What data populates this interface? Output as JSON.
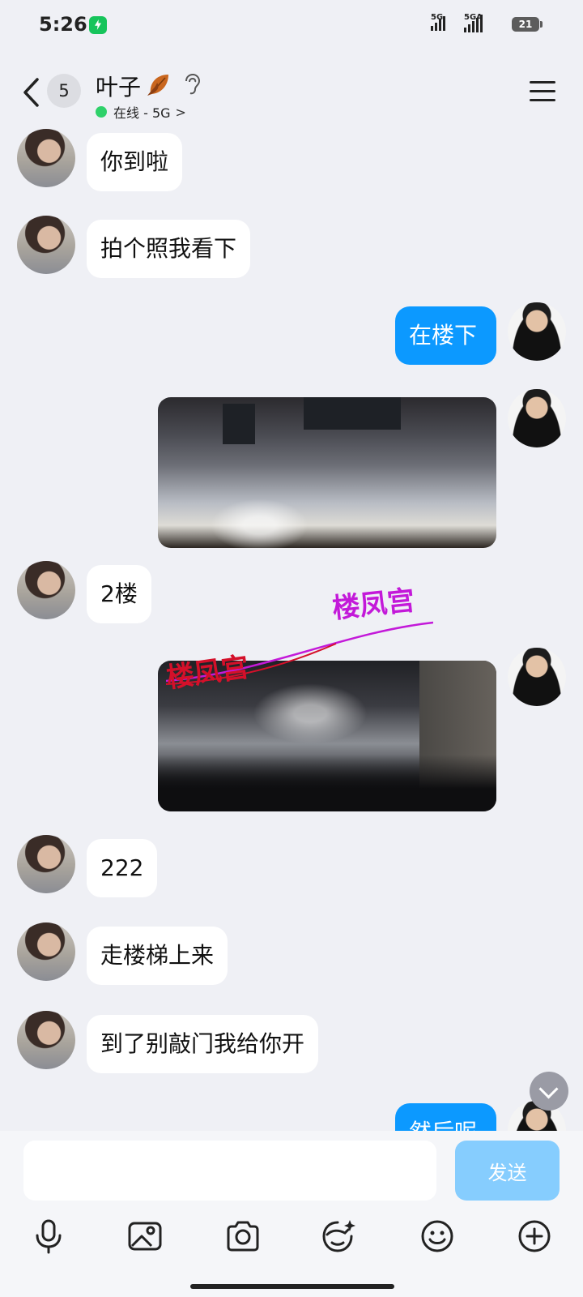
{
  "status_bar": {
    "time": "5:26",
    "signal1_label": "5G",
    "signal2_label": "5GA",
    "battery": "21"
  },
  "header": {
    "unread_count": "5",
    "contact_name": "叶子",
    "status": "在线 - 5G",
    "status_chevron": ">"
  },
  "messages": [
    {
      "side": "in",
      "type": "text",
      "text": "你到啦"
    },
    {
      "side": "in",
      "type": "text",
      "text": "拍个照我看下"
    },
    {
      "side": "out",
      "type": "text",
      "text": "在楼下"
    },
    {
      "side": "out",
      "type": "image",
      "scene": "building-entrance-night"
    },
    {
      "side": "in",
      "type": "text",
      "text": "2楼"
    },
    {
      "side": "out",
      "type": "image",
      "scene": "parking-area-night",
      "watermark_1": "楼凤宫",
      "watermark_2": "楼凤宫"
    },
    {
      "side": "in",
      "type": "text",
      "text": "222"
    },
    {
      "side": "in",
      "type": "text",
      "text": "走楼梯上来"
    },
    {
      "side": "in",
      "type": "text",
      "text": "到了别敲门我给你开"
    },
    {
      "side": "out",
      "type": "text",
      "text": "然后呢"
    }
  ],
  "composer": {
    "input_value": "",
    "input_placeholder": "",
    "send_label": "发送"
  },
  "toolbar": {
    "icons": [
      "microphone-icon",
      "image-icon",
      "camera-icon",
      "sticker-icon",
      "emoji-icon",
      "plus-icon"
    ]
  },
  "colors": {
    "background": "#eff0f5",
    "outgoing_bubble": "#0c99ff",
    "incoming_bubble": "#ffffff",
    "send_button": "#86cdfe",
    "online_dot": "#2fd16a",
    "watermark_purple": "#c319d9",
    "watermark_red": "#d4102a"
  }
}
